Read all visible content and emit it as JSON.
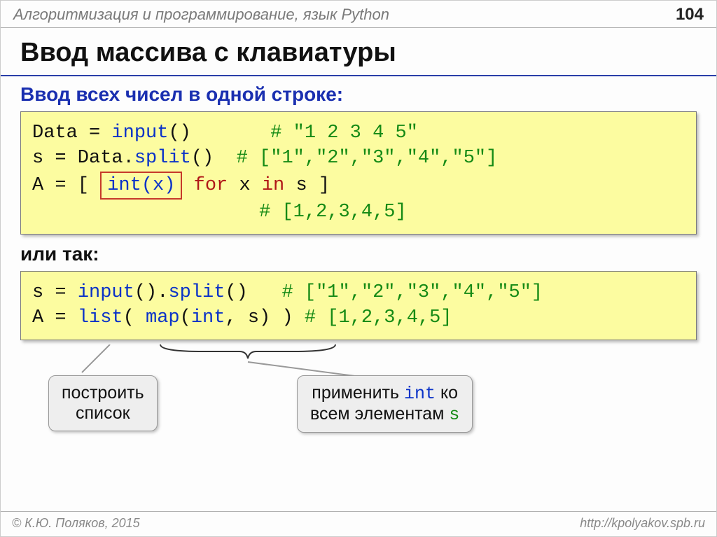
{
  "header": {
    "title": "Алгоритмизация и программирование, язык Python",
    "page_number": "104"
  },
  "title": "Ввод массива с клавиатуры",
  "section1": {
    "lead": "Ввод всех чисел в одной строке:",
    "code": {
      "l1_a": "Data",
      "l1_b": " = ",
      "l1_c": "input",
      "l1_d": "()       ",
      "l1_e": "# \"1 2 3 4 5\"",
      "l2_a": "s",
      "l2_b": " = Data.",
      "l2_c": "split",
      "l2_d": "()  ",
      "l2_e": "# [\"1\",\"2\",\"3\",\"4\",\"5\"]",
      "l3_a": "A",
      "l3_b": " = [ ",
      "l3_intx": "int(x)",
      "l3_c": " ",
      "l3_for": "for",
      "l3_d": " x ",
      "l3_in": "in",
      "l3_e": " s ]",
      "l4_pad": "                    ",
      "l4_e": "# [1,2,3,4,5]"
    }
  },
  "or_text": "или так:",
  "section2": {
    "code": {
      "l1_a": "s",
      "l1_b": " = ",
      "l1_c": "input",
      "l1_d": "().",
      "l1_e": "split",
      "l1_f": "()   ",
      "l1_g": "# [\"1\",\"2\",\"3\",\"4\",\"5\"]",
      "l2_a": "A",
      "l2_b": " = ",
      "l2_c": "list",
      "l2_d": "( ",
      "l2_e": "map",
      "l2_f": "(",
      "l2_g": "int",
      "l2_h": ", s) ) ",
      "l2_i": "# [1,2,3,4,5]"
    }
  },
  "callouts": {
    "left": {
      "line1": "построить",
      "line2": "список"
    },
    "right": {
      "prefix": "применить ",
      "int": "int",
      "suffix": " ко",
      "line2_a": "всем элементам ",
      "line2_b": "s"
    }
  },
  "footer": {
    "left": "© К.Ю. Поляков, 2015",
    "right": "http://kpolyakov.spb.ru"
  }
}
